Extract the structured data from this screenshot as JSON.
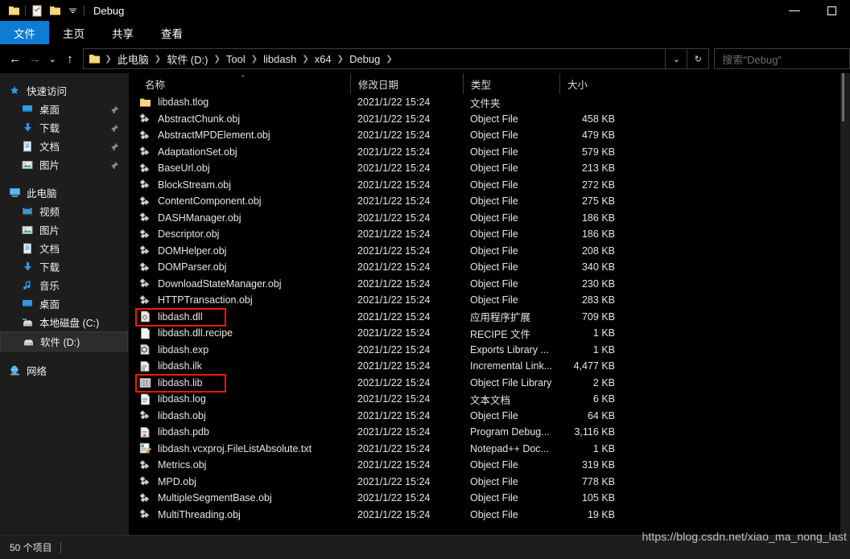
{
  "window": {
    "title": "Debug",
    "quick_access": [
      {
        "name": "folder-icon",
        "label": ""
      },
      {
        "name": "properties-icon",
        "label": ""
      },
      {
        "name": "new-folder-icon",
        "label": ""
      },
      {
        "name": "chevron-down-icon",
        "label": ""
      }
    ],
    "controls": {
      "minimize": "minimize",
      "maximize": "maximize"
    }
  },
  "ribbon": {
    "tabs": [
      {
        "label": "文件",
        "active": true
      },
      {
        "label": "主页",
        "active": false
      },
      {
        "label": "共享",
        "active": false
      },
      {
        "label": "查看",
        "active": false
      }
    ]
  },
  "navigation": {
    "back": "←",
    "forward": "→",
    "recent": "⌄",
    "up": "↑",
    "breadcrumbs": [
      "此电脑",
      "软件 (D:)",
      "Tool",
      "libdash",
      "x64",
      "Debug"
    ],
    "history_dropdown": "⌄",
    "refresh": "↻"
  },
  "search": {
    "placeholder": "搜索\"Debug\"",
    "value": ""
  },
  "sidebar": {
    "groups": [
      {
        "header": {
          "label": "快速访问",
          "icon": "star-pin-icon"
        },
        "items": [
          {
            "label": "桌面",
            "icon": "desktop-icon",
            "pinned": true
          },
          {
            "label": "下载",
            "icon": "downloads-icon",
            "pinned": true
          },
          {
            "label": "文档",
            "icon": "documents-icon",
            "pinned": true
          },
          {
            "label": "图片",
            "icon": "pictures-icon",
            "pinned": true
          }
        ]
      },
      {
        "header": {
          "label": "此电脑",
          "icon": "this-pc-icon"
        },
        "items": [
          {
            "label": "视频",
            "icon": "videos-icon",
            "pinned": false
          },
          {
            "label": "图片",
            "icon": "pictures-icon",
            "pinned": false
          },
          {
            "label": "文档",
            "icon": "documents-icon",
            "pinned": false
          },
          {
            "label": "下载",
            "icon": "downloads-icon",
            "pinned": false
          },
          {
            "label": "音乐",
            "icon": "music-icon",
            "pinned": false
          },
          {
            "label": "桌面",
            "icon": "desktop-icon",
            "pinned": false
          },
          {
            "label": "本地磁盘 (C:)",
            "icon": "local-disk-icon",
            "pinned": false
          },
          {
            "label": "软件 (D:)",
            "icon": "drive-icon",
            "pinned": false,
            "selected": true
          }
        ]
      },
      {
        "header": {
          "label": "网络",
          "icon": "network-icon"
        },
        "items": []
      }
    ]
  },
  "file_list": {
    "columns": [
      {
        "label": "名称",
        "key": "name"
      },
      {
        "label": "修改日期",
        "key": "date"
      },
      {
        "label": "类型",
        "key": "type"
      },
      {
        "label": "大小",
        "key": "size"
      }
    ],
    "sort": {
      "column": "名称",
      "direction": "asc",
      "marker": "⌃"
    },
    "rows": [
      {
        "name": "libdash.tlog",
        "date": "2021/1/22 15:24",
        "type": "文件夹",
        "size": "",
        "icon": "folder-icon"
      },
      {
        "name": "AbstractChunk.obj",
        "date": "2021/1/22 15:24",
        "type": "Object File",
        "size": "458 KB",
        "icon": "object-file-icon"
      },
      {
        "name": "AbstractMPDElement.obj",
        "date": "2021/1/22 15:24",
        "type": "Object File",
        "size": "479 KB",
        "icon": "object-file-icon"
      },
      {
        "name": "AdaptationSet.obj",
        "date": "2021/1/22 15:24",
        "type": "Object File",
        "size": "579 KB",
        "icon": "object-file-icon"
      },
      {
        "name": "BaseUrl.obj",
        "date": "2021/1/22 15:24",
        "type": "Object File",
        "size": "213 KB",
        "icon": "object-file-icon"
      },
      {
        "name": "BlockStream.obj",
        "date": "2021/1/22 15:24",
        "type": "Object File",
        "size": "272 KB",
        "icon": "object-file-icon"
      },
      {
        "name": "ContentComponent.obj",
        "date": "2021/1/22 15:24",
        "type": "Object File",
        "size": "275 KB",
        "icon": "object-file-icon"
      },
      {
        "name": "DASHManager.obj",
        "date": "2021/1/22 15:24",
        "type": "Object File",
        "size": "186 KB",
        "icon": "object-file-icon"
      },
      {
        "name": "Descriptor.obj",
        "date": "2021/1/22 15:24",
        "type": "Object File",
        "size": "186 KB",
        "icon": "object-file-icon"
      },
      {
        "name": "DOMHelper.obj",
        "date": "2021/1/22 15:24",
        "type": "Object File",
        "size": "208 KB",
        "icon": "object-file-icon"
      },
      {
        "name": "DOMParser.obj",
        "date": "2021/1/22 15:24",
        "type": "Object File",
        "size": "340 KB",
        "icon": "object-file-icon"
      },
      {
        "name": "DownloadStateManager.obj",
        "date": "2021/1/22 15:24",
        "type": "Object File",
        "size": "230 KB",
        "icon": "object-file-icon"
      },
      {
        "name": "HTTPTransaction.obj",
        "date": "2021/1/22 15:24",
        "type": "Object File",
        "size": "283 KB",
        "icon": "object-file-icon"
      },
      {
        "name": "libdash.dll",
        "date": "2021/1/22 15:24",
        "type": "应用程序扩展",
        "size": "709 KB",
        "icon": "dll-icon",
        "highlighted": true
      },
      {
        "name": "libdash.dll.recipe",
        "date": "2021/1/22 15:24",
        "type": "RECIPE 文件",
        "size": "1 KB",
        "icon": "blank-file-icon"
      },
      {
        "name": "libdash.exp",
        "date": "2021/1/22 15:24",
        "type": "Exports Library ...",
        "size": "1 KB",
        "icon": "exports-icon"
      },
      {
        "name": "libdash.ilk",
        "date": "2021/1/22 15:24",
        "type": "Incremental Link...",
        "size": "4,477 KB",
        "icon": "ilk-icon"
      },
      {
        "name": "libdash.lib",
        "date": "2021/1/22 15:24",
        "type": "Object File Library",
        "size": "2 KB",
        "icon": "lib-icon",
        "highlighted": true
      },
      {
        "name": "libdash.log",
        "date": "2021/1/22 15:24",
        "type": "文本文档",
        "size": "6 KB",
        "icon": "text-file-icon"
      },
      {
        "name": "libdash.obj",
        "date": "2021/1/22 15:24",
        "type": "Object File",
        "size": "64 KB",
        "icon": "object-file-icon"
      },
      {
        "name": "libdash.pdb",
        "date": "2021/1/22 15:24",
        "type": "Program Debug...",
        "size": "3,116 KB",
        "icon": "pdb-icon"
      },
      {
        "name": "libdash.vcxproj.FileListAbsolute.txt",
        "date": "2021/1/22 15:24",
        "type": "Notepad++ Doc...",
        "size": "1 KB",
        "icon": "notepadpp-icon"
      },
      {
        "name": "Metrics.obj",
        "date": "2021/1/22 15:24",
        "type": "Object File",
        "size": "319 KB",
        "icon": "object-file-icon"
      },
      {
        "name": "MPD.obj",
        "date": "2021/1/22 15:24",
        "type": "Object File",
        "size": "778 KB",
        "icon": "object-file-icon"
      },
      {
        "name": "MultipleSegmentBase.obj",
        "date": "2021/1/22 15:24",
        "type": "Object File",
        "size": "105 KB",
        "icon": "object-file-icon"
      },
      {
        "name": "MultiThreading.obj",
        "date": "2021/1/22 15:24",
        "type": "Object File",
        "size": "19 KB",
        "icon": "object-file-icon"
      }
    ]
  },
  "status": {
    "item_count": "50 个项目"
  },
  "watermark": {
    "text": "https://blog.csdn.net/xiao_ma_nong_last"
  },
  "colors": {
    "accent": "#0c7cd5",
    "highlight_box": "#fa1607",
    "folder": "#f7d77c",
    "background": "#000000",
    "panel": "#1d1d1d"
  }
}
